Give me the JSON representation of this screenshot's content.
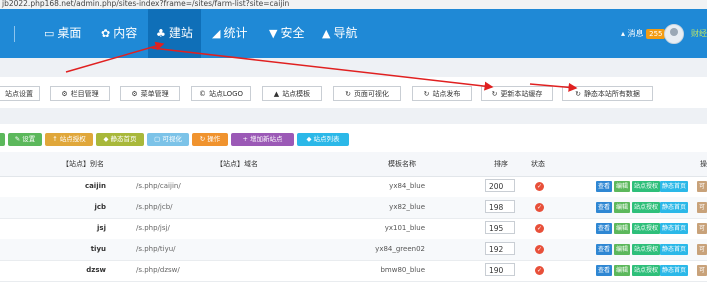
{
  "browser": {
    "url": "jb2022.php168.net/admin.php/sites-index?frame=/sites/farm-list?site=caijin"
  },
  "nav": {
    "items": [
      {
        "icon": "desktop-icon",
        "glyph": "▭",
        "label": "桌面"
      },
      {
        "icon": "content-icon",
        "glyph": "✿",
        "label": "内容"
      },
      {
        "icon": "site-icon",
        "glyph": "♣",
        "label": "建站"
      },
      {
        "icon": "stats-icon",
        "glyph": "◢",
        "label": "统计"
      },
      {
        "icon": "shield-icon",
        "glyph": "▼",
        "label": "安全"
      },
      {
        "icon": "nav-guide-icon",
        "glyph": "▲",
        "label": "导航"
      }
    ],
    "messages_label": "▴ 消息",
    "messages_count": "255",
    "user_name": "财经"
  },
  "toolbar": [
    "站点设置",
    "栏目管理",
    "菜单管理",
    "站点LOGO",
    "站点模板",
    "页面可视化",
    "站点发布",
    "更新本站缓存",
    "静态本站所有数据"
  ],
  "actions": [
    {
      "label": "设置",
      "color": "#5cb85c"
    },
    {
      "label": "站点授权",
      "color": "#e0a73a"
    },
    {
      "label": "静态首页",
      "color": "#a8b83a"
    },
    {
      "label": "可视化",
      "color": "#7cc3e8"
    },
    {
      "label": "操作",
      "color": "#f0932e"
    },
    {
      "label": "增加新站点",
      "color": "#9b59b6"
    },
    {
      "label": "站点列表",
      "color": "#2bb8e8"
    }
  ],
  "table": {
    "headers": [
      "【站点】别名",
      "【站点】域名",
      "模板名称",
      "排序",
      "状态",
      "操"
    ],
    "rows": [
      {
        "name": "caijin",
        "domain": "/s.php/caijin/",
        "template": "yx84_blue",
        "sort": "200"
      },
      {
        "name": "jcb",
        "domain": "/s.php/jcb/",
        "template": "yx82_blue",
        "sort": "198"
      },
      {
        "name": "jsj",
        "domain": "/s.php/jsj/",
        "template": "yx101_blue",
        "sort": "195"
      },
      {
        "name": "tiyu",
        "domain": "/s.php/tiyu/",
        "template": "yx84_green02",
        "sort": "192"
      },
      {
        "name": "dzsw",
        "domain": "/s.php/dzsw/",
        "template": "bmw80_blue",
        "sort": "190"
      }
    ],
    "row_ops": [
      {
        "label": "查看",
        "color": "#2f87d3"
      },
      {
        "label": "编辑",
        "color": "#5cb85c"
      },
      {
        "label": "站点授权",
        "color": "#2ebf7a"
      },
      {
        "label": "静态首页",
        "color": "#2bb8e8"
      },
      {
        "label": "可",
        "color": "#c8a27a"
      }
    ]
  }
}
